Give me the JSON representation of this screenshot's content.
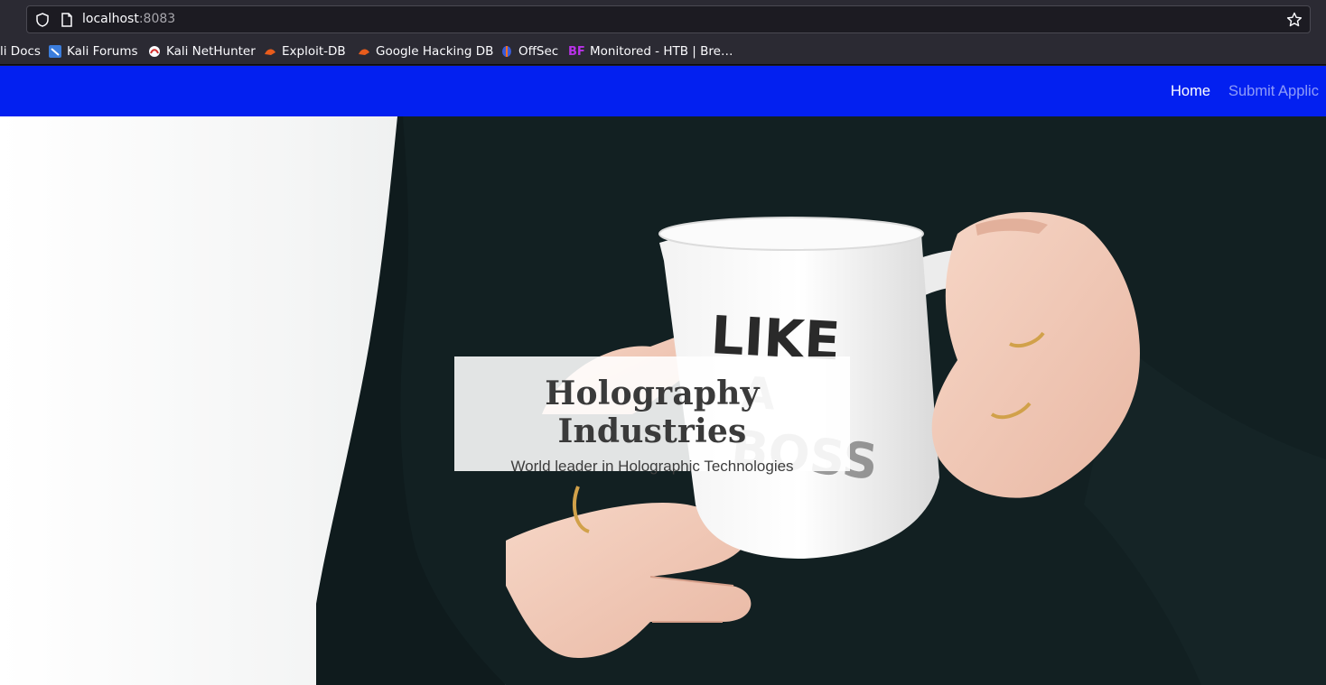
{
  "browser": {
    "url_host": "localhost",
    "url_port": ":8083",
    "bookmarks": [
      {
        "label": "li Docs",
        "icon": "kali-docs-icon"
      },
      {
        "label": "Kali Forums",
        "icon": "kali-forums-icon"
      },
      {
        "label": "Kali NetHunter",
        "icon": "kali-nethunter-icon"
      },
      {
        "label": "Exploit-DB",
        "icon": "exploit-db-icon"
      },
      {
        "label": "Google Hacking DB",
        "icon": "ghdb-icon"
      },
      {
        "label": "OffSec",
        "icon": "offsec-icon"
      },
      {
        "label": "Monitored - HTB | Bre…",
        "icon": "bf-icon"
      }
    ]
  },
  "nav": {
    "home": "Home",
    "submit": "Submit Applic"
  },
  "hero": {
    "title": "Holography Industries",
    "subtitle": "World leader in Holographic Technologies",
    "mug_text": "LIKE A BOSS"
  },
  "colors": {
    "navbar": "#0320f0",
    "browser_chrome": "#2b2a33",
    "sweater": "#122022"
  }
}
